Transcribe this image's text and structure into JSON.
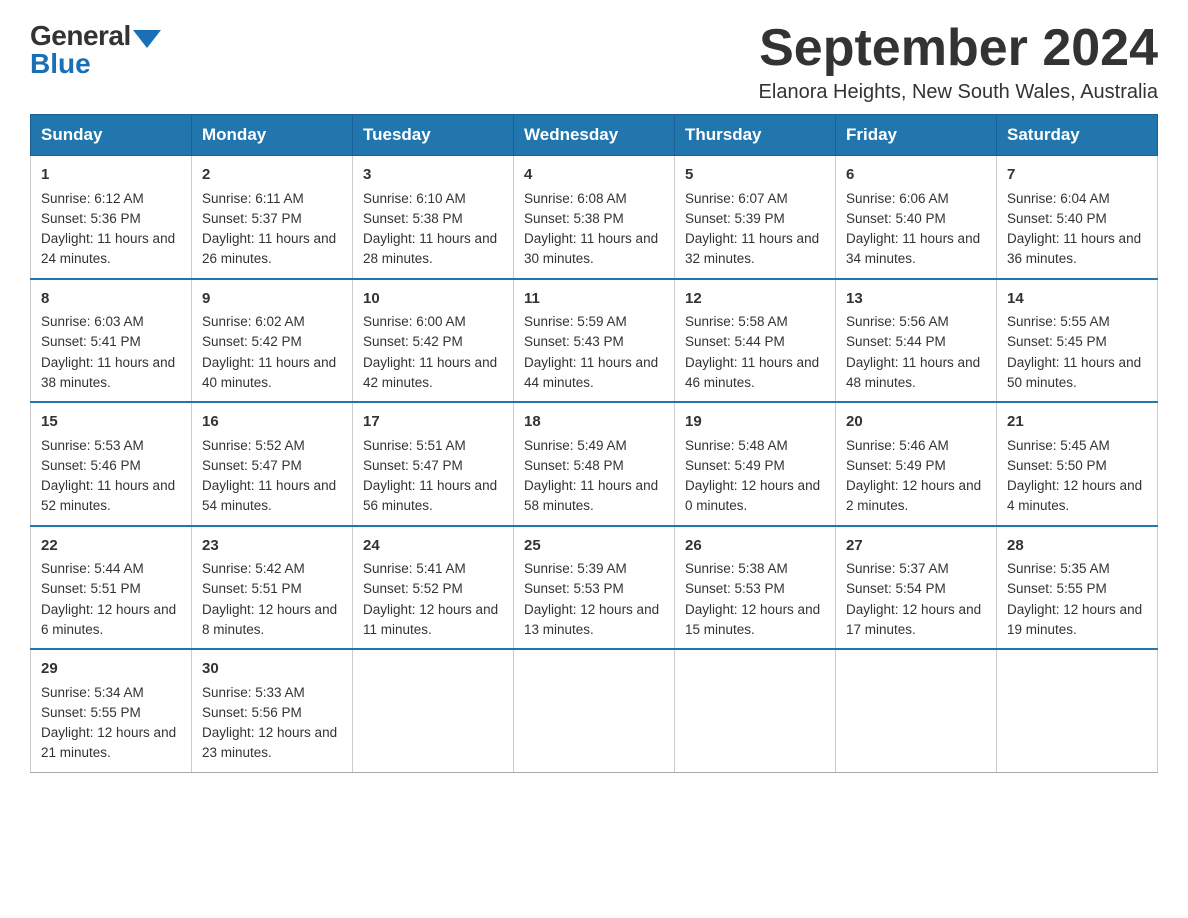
{
  "logo": {
    "general": "General",
    "blue": "Blue"
  },
  "title": "September 2024",
  "location": "Elanora Heights, New South Wales, Australia",
  "days": [
    "Sunday",
    "Monday",
    "Tuesday",
    "Wednesday",
    "Thursday",
    "Friday",
    "Saturday"
  ],
  "weeks": [
    [
      {
        "day": "1",
        "sunrise": "6:12 AM",
        "sunset": "5:36 PM",
        "daylight": "11 hours and 24 minutes."
      },
      {
        "day": "2",
        "sunrise": "6:11 AM",
        "sunset": "5:37 PM",
        "daylight": "11 hours and 26 minutes."
      },
      {
        "day": "3",
        "sunrise": "6:10 AM",
        "sunset": "5:38 PM",
        "daylight": "11 hours and 28 minutes."
      },
      {
        "day": "4",
        "sunrise": "6:08 AM",
        "sunset": "5:38 PM",
        "daylight": "11 hours and 30 minutes."
      },
      {
        "day": "5",
        "sunrise": "6:07 AM",
        "sunset": "5:39 PM",
        "daylight": "11 hours and 32 minutes."
      },
      {
        "day": "6",
        "sunrise": "6:06 AM",
        "sunset": "5:40 PM",
        "daylight": "11 hours and 34 minutes."
      },
      {
        "day": "7",
        "sunrise": "6:04 AM",
        "sunset": "5:40 PM",
        "daylight": "11 hours and 36 minutes."
      }
    ],
    [
      {
        "day": "8",
        "sunrise": "6:03 AM",
        "sunset": "5:41 PM",
        "daylight": "11 hours and 38 minutes."
      },
      {
        "day": "9",
        "sunrise": "6:02 AM",
        "sunset": "5:42 PM",
        "daylight": "11 hours and 40 minutes."
      },
      {
        "day": "10",
        "sunrise": "6:00 AM",
        "sunset": "5:42 PM",
        "daylight": "11 hours and 42 minutes."
      },
      {
        "day": "11",
        "sunrise": "5:59 AM",
        "sunset": "5:43 PM",
        "daylight": "11 hours and 44 minutes."
      },
      {
        "day": "12",
        "sunrise": "5:58 AM",
        "sunset": "5:44 PM",
        "daylight": "11 hours and 46 minutes."
      },
      {
        "day": "13",
        "sunrise": "5:56 AM",
        "sunset": "5:44 PM",
        "daylight": "11 hours and 48 minutes."
      },
      {
        "day": "14",
        "sunrise": "5:55 AM",
        "sunset": "5:45 PM",
        "daylight": "11 hours and 50 minutes."
      }
    ],
    [
      {
        "day": "15",
        "sunrise": "5:53 AM",
        "sunset": "5:46 PM",
        "daylight": "11 hours and 52 minutes."
      },
      {
        "day": "16",
        "sunrise": "5:52 AM",
        "sunset": "5:47 PM",
        "daylight": "11 hours and 54 minutes."
      },
      {
        "day": "17",
        "sunrise": "5:51 AM",
        "sunset": "5:47 PM",
        "daylight": "11 hours and 56 minutes."
      },
      {
        "day": "18",
        "sunrise": "5:49 AM",
        "sunset": "5:48 PM",
        "daylight": "11 hours and 58 minutes."
      },
      {
        "day": "19",
        "sunrise": "5:48 AM",
        "sunset": "5:49 PM",
        "daylight": "12 hours and 0 minutes."
      },
      {
        "day": "20",
        "sunrise": "5:46 AM",
        "sunset": "5:49 PM",
        "daylight": "12 hours and 2 minutes."
      },
      {
        "day": "21",
        "sunrise": "5:45 AM",
        "sunset": "5:50 PM",
        "daylight": "12 hours and 4 minutes."
      }
    ],
    [
      {
        "day": "22",
        "sunrise": "5:44 AM",
        "sunset": "5:51 PM",
        "daylight": "12 hours and 6 minutes."
      },
      {
        "day": "23",
        "sunrise": "5:42 AM",
        "sunset": "5:51 PM",
        "daylight": "12 hours and 8 minutes."
      },
      {
        "day": "24",
        "sunrise": "5:41 AM",
        "sunset": "5:52 PM",
        "daylight": "12 hours and 11 minutes."
      },
      {
        "day": "25",
        "sunrise": "5:39 AM",
        "sunset": "5:53 PM",
        "daylight": "12 hours and 13 minutes."
      },
      {
        "day": "26",
        "sunrise": "5:38 AM",
        "sunset": "5:53 PM",
        "daylight": "12 hours and 15 minutes."
      },
      {
        "day": "27",
        "sunrise": "5:37 AM",
        "sunset": "5:54 PM",
        "daylight": "12 hours and 17 minutes."
      },
      {
        "day": "28",
        "sunrise": "5:35 AM",
        "sunset": "5:55 PM",
        "daylight": "12 hours and 19 minutes."
      }
    ],
    [
      {
        "day": "29",
        "sunrise": "5:34 AM",
        "sunset": "5:55 PM",
        "daylight": "12 hours and 21 minutes."
      },
      {
        "day": "30",
        "sunrise": "5:33 AM",
        "sunset": "5:56 PM",
        "daylight": "12 hours and 23 minutes."
      },
      null,
      null,
      null,
      null,
      null
    ]
  ],
  "labels": {
    "sunrise": "Sunrise: ",
    "sunset": "Sunset: ",
    "daylight": "Daylight: "
  }
}
